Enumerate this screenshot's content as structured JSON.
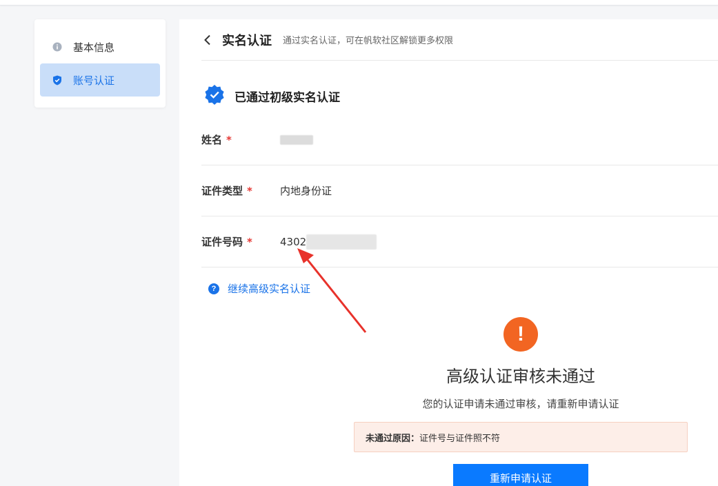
{
  "sidebar": {
    "items": [
      {
        "label": "基本信息",
        "icon": "info-icon",
        "active": false
      },
      {
        "label": "账号认证",
        "icon": "shield-check-icon",
        "active": true
      }
    ]
  },
  "header": {
    "title": "实名认证",
    "subtitle": "通过实名认证，可在帆软社区解锁更多权限"
  },
  "verified": {
    "text": "已通过初级实名认证",
    "icon": "verified-badge-icon"
  },
  "fields": {
    "name": {
      "label": "姓名",
      "required": "*",
      "value": ""
    },
    "id_type": {
      "label": "证件类型",
      "required": "*",
      "value": "内地身份证"
    },
    "id_number": {
      "label": "证件号码",
      "required": "*",
      "value": "4302"
    }
  },
  "continue_link": {
    "label": "继续高级实名认证",
    "icon": "question-icon"
  },
  "result": {
    "icon_glyph": "!",
    "title": "高级认证审核未通过",
    "description": "您的认证申请未通过审核，请重新申请认证",
    "reason_label": "未通过原因：",
    "reason_text": "证件号与证件照不符",
    "button_label": "重新申请认证"
  },
  "colors": {
    "accent": "#1a73e8",
    "button": "#0a7aff",
    "warning": "#f26522",
    "required": "#e53935",
    "annotation_arrow": "#e8322b"
  }
}
